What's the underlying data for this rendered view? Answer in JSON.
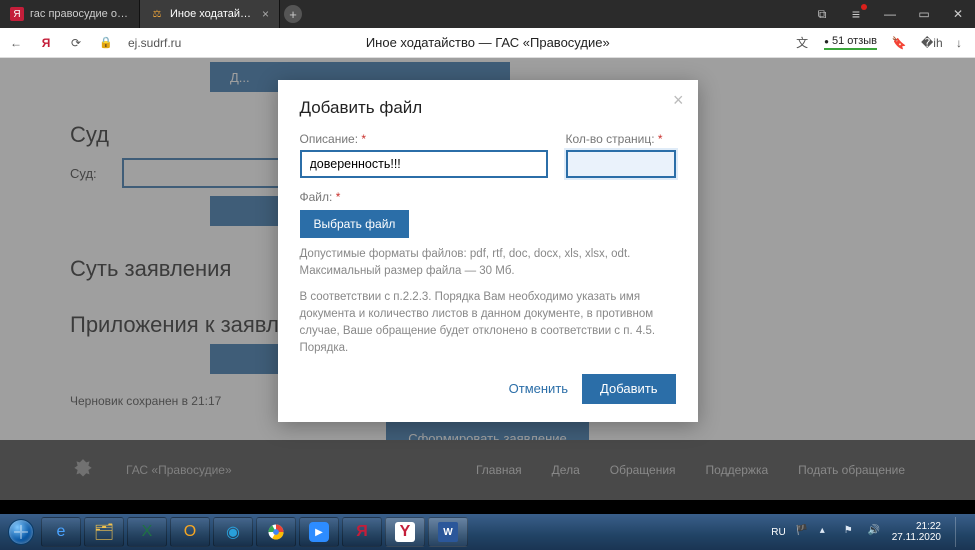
{
  "browser": {
    "tabs": [
      {
        "title": "гас правосудие официаль",
        "favicon": "Я"
      },
      {
        "title": "Иное ходатайство — Г...",
        "favicon": "⚖"
      }
    ],
    "newtab": "+",
    "window_controls": {
      "copy": "⧉",
      "list": "≡",
      "min": "—",
      "max": "▭",
      "close": "✕"
    },
    "nav": {
      "back": "←",
      "ya": "Я",
      "reload": "⟳",
      "lock": "🔒"
    },
    "url": "ej.sudrf.ru",
    "page_title": "Иное ходатайство — ГАС «Правосудие»",
    "right": {
      "translate": "文",
      "reviews": "51 отзыв",
      "bookmark": "🔖",
      "ext": "�ih",
      "dl": "↓"
    }
  },
  "page": {
    "add_button_trunc": "Д...",
    "section_court": "Суд",
    "court_label": "Суд:",
    "section_essence": "Суть заявления",
    "section_attach": "Приложения к заявл",
    "draft_saved": "Черновик сохранен в 21:17",
    "submit": "Сформировать заявление"
  },
  "footer": {
    "brand": "ГАС «Правосудие»",
    "links": [
      "Главная",
      "Дела",
      "Обращения",
      "Поддержка",
      "Подать обращение"
    ]
  },
  "modal": {
    "title": "Добавить файл",
    "close": "×",
    "desc_label": "Описание:",
    "desc_value": "доверенность!!!",
    "pages_label": "Кол-во страниц:",
    "pages_value": "",
    "file_label": "Файл:",
    "pick": "Выбрать файл",
    "hint1": "Допустимые форматы файлов: pdf, rtf, doc, docx, xls, xlsx, odt. Максимальный размер файла — 30 Мб.",
    "hint2": "В соответствии с п.2.2.3. Порядка Вам необходимо указать имя документа и количество листов в данном документе, в противном случае, Ваше обращение будет отклонено в соответствии с п. 4.5. Порядка.",
    "cancel": "Отменить",
    "add": "Добавить",
    "star": "*"
  },
  "taskbar": {
    "lang": "RU",
    "time": "21:22",
    "date": "27.11.2020"
  }
}
